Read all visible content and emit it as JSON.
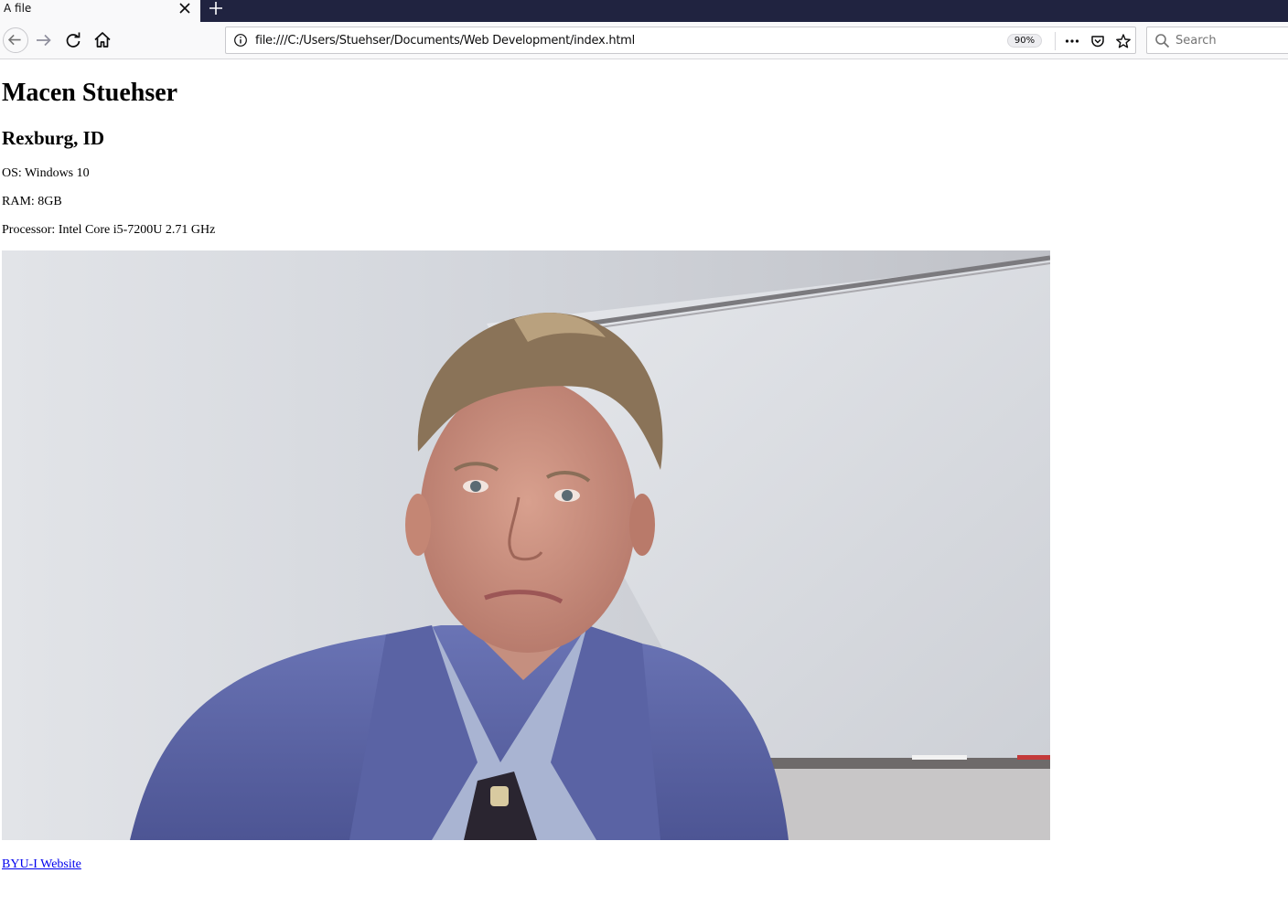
{
  "browser": {
    "tab": {
      "title": "A file"
    },
    "address_bar": {
      "url": "file:///C:/Users/Stuehser/Documents/Web Development/index.html",
      "zoom": "90%"
    },
    "search_bar": {
      "placeholder": "Search"
    },
    "icons": {
      "tab_close": "close-icon",
      "new_tab": "plus-icon",
      "back": "back-arrow-icon",
      "forward": "forward-arrow-icon",
      "reload": "reload-icon",
      "home": "home-icon",
      "site_info": "info-icon",
      "page_actions": "more-horizontal-icon",
      "pocket": "pocket-icon",
      "bookmark": "star-icon",
      "search": "search-icon"
    },
    "colors": {
      "tabstrip": "#202340",
      "toolbar": "#f9f9fa"
    }
  },
  "page": {
    "heading": "Macen Stuehser",
    "subheading": "Rexburg, ID",
    "specs": {
      "os": "OS: Windows 10",
      "ram": "RAM: 8GB",
      "processor": "Processor: Intel Core i5-7200U 2.71 GHz"
    },
    "link": {
      "text": "BYU-I Website",
      "color": "#0000ee"
    }
  }
}
